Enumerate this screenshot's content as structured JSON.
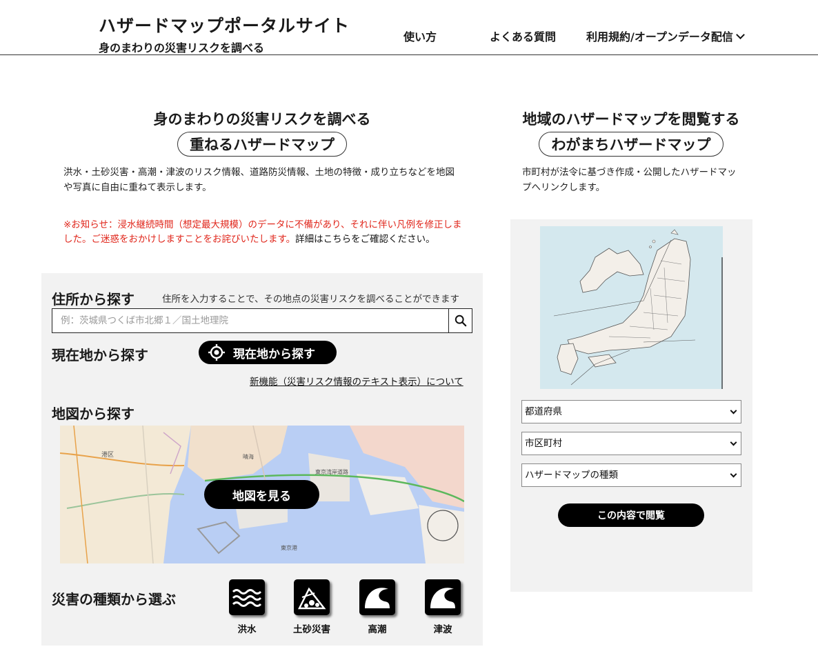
{
  "header": {
    "title": "ハザードマップポータルサイト",
    "subtitle": "身のまわりの災害リスクを調べる",
    "nav": [
      {
        "label": "使い方"
      },
      {
        "label": "よくある質問"
      },
      {
        "label": "利用規約/オープンデータ配信"
      }
    ]
  },
  "left": {
    "heading": "身のまわりの災害リスクを調べる",
    "pill": "重ねるハザードマップ",
    "description": "洪水・土砂災害・高潮・津波のリスク情報、道路防災情報、土地の特徴・成り立ちなどを地図や写真に自由に重ねて表示します。",
    "notice_red": "※お知らせ：浸水継続時間（想定最大規模）のデータに不備があり、それに伴い凡例を修正しました。ご迷惑をおかけしますことをお詫びいたします。",
    "notice_detail": "詳細はこちらをご確認ください。",
    "address": {
      "label": "住所から探す",
      "hint": "住所を入力することで、その地点の災害リスクを調べることができます",
      "placeholder": "例：茨城県つくば市北郷１／国土地理院"
    },
    "gps": {
      "label": "現在地から探す",
      "button": "現在地から探す"
    },
    "new_feature_link": "新機能（災害リスク情報のテキスト表示）について",
    "map": {
      "label": "地図から探す",
      "button": "地図を見る",
      "place_labels": [
        "港区",
        "東京湾岸道路",
        "晴海",
        "東京港"
      ]
    },
    "hazards": {
      "label": "災害の種類から選ぶ",
      "items": [
        {
          "label": "洪水",
          "icon": "flood-icon"
        },
        {
          "label": "土砂災害",
          "icon": "landslide-icon"
        },
        {
          "label": "高潮",
          "icon": "storm-surge-icon"
        },
        {
          "label": "津波",
          "icon": "tsunami-icon"
        }
      ]
    }
  },
  "right": {
    "heading": "地域のハザードマップを閲覧する",
    "pill": "わがまちハザードマップ",
    "description": "市町村が法令に基づき作成・公開したハザードマップへリンクします。",
    "selects": [
      {
        "value": "都道府県"
      },
      {
        "value": "市区町村"
      },
      {
        "value": "ハザードマップの種類"
      }
    ],
    "view_button": "この内容で閲覧"
  },
  "colors": {
    "accent": "#000000",
    "notice": "#e0261b",
    "panel": "#f2f2f2",
    "sea": "#d4e8ee",
    "land": "#f3efe9"
  }
}
